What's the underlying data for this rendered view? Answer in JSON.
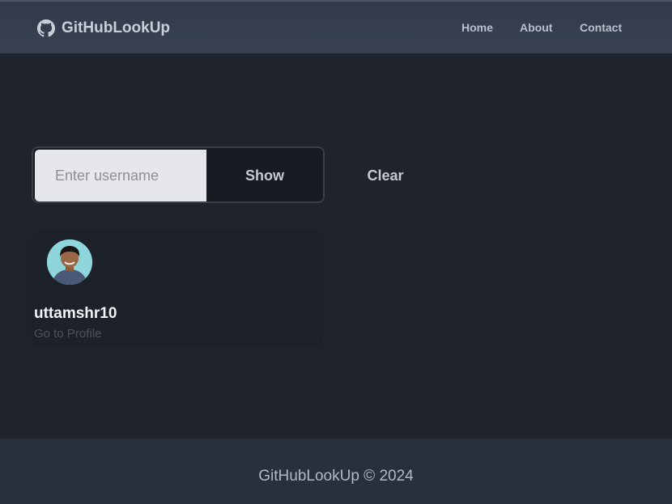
{
  "navbar": {
    "brand": {
      "label": "GitHubLookUp",
      "icon": "github-icon"
    },
    "links": [
      {
        "label": "Home"
      },
      {
        "label": "About"
      },
      {
        "label": "Contact"
      }
    ]
  },
  "search": {
    "value": "",
    "placeholder": "Enter username",
    "show_label": "Show",
    "clear_label": "Clear"
  },
  "user_card": {
    "username": "uttamshr10",
    "profile_link": "Go to Profile",
    "avatar_icon": "avatar-photo"
  },
  "footer": {
    "text": "GitHubLookUp © 2024"
  },
  "colors": {
    "page_bg": "#1f232c",
    "navbar_bg": "#394253",
    "footer_bg": "#2a303b",
    "input_bg": "#e6e7ea",
    "button_bg": "#181b21"
  }
}
